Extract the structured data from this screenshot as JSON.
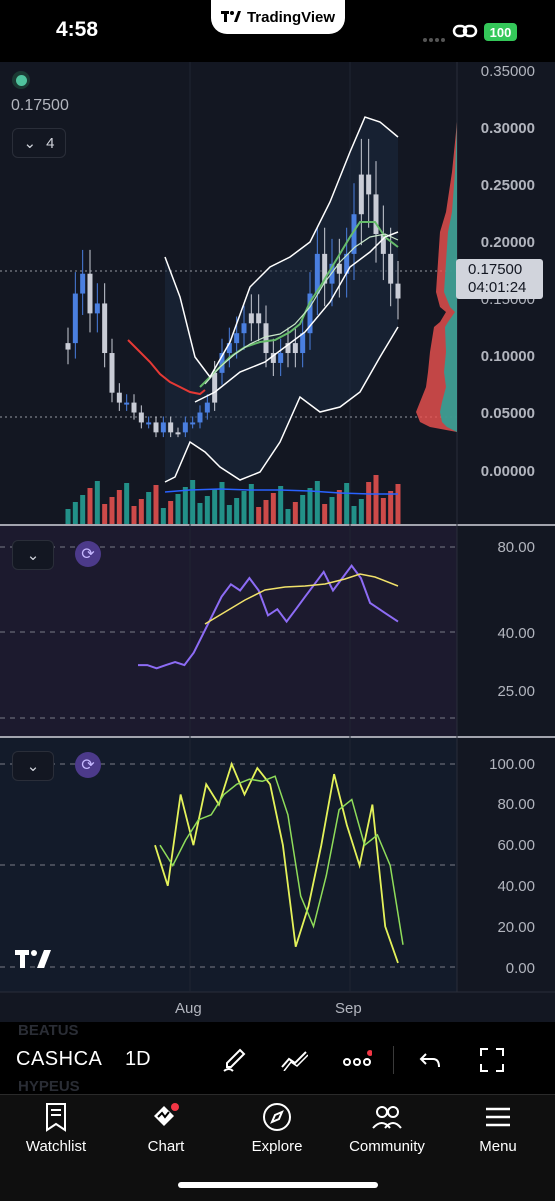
{
  "status_bar": {
    "time": "4:58",
    "brand": "TradingView",
    "battery": "100",
    "icons": [
      "signal-dots-icon",
      "link-icon",
      "battery-icon"
    ]
  },
  "chart": {
    "last_price": "0.17500",
    "indicator_count": "4",
    "price_badge_price": "0.17500",
    "price_badge_countdown": "04:01:24",
    "price_axis": [
      "0.35000",
      "0.30000",
      "0.25000",
      "0.20000",
      "0.15000",
      "0.10000",
      "0.05000",
      "0.00000"
    ],
    "rsi_axis": [
      "80.00",
      "40.00",
      "25.00"
    ],
    "stoch_axis": [
      "100.00",
      "80.00",
      "60.00",
      "40.00",
      "20.00",
      "0.00"
    ],
    "date_axis": [
      "Aug",
      "Sep"
    ],
    "colors": {
      "up": "#26a69a",
      "down": "#ef5350",
      "candle_up_blue": "#4a7fe0",
      "candle_white": "#c9ccd6",
      "rsi": "#8d6cf5",
      "rsi_ma": "#f1e26a",
      "stoch_k": "#e4f25a",
      "stoch_d": "#8fdc5a",
      "background": "#131722"
    }
  },
  "chart_data": {
    "type": "line",
    "x_labels": [
      "Aug",
      "Sep"
    ],
    "price_ylim": [
      0,
      0.35
    ],
    "last_price": 0.175,
    "close": [
      0.13,
      0.18,
      0.2,
      0.16,
      0.17,
      0.12,
      0.08,
      0.07,
      0.07,
      0.06,
      0.05,
      0.05,
      0.04,
      0.05,
      0.04,
      0.04,
      0.05,
      0.05,
      0.06,
      0.07,
      0.1,
      0.12,
      0.13,
      0.14,
      0.15,
      0.16,
      0.15,
      0.12,
      0.11,
      0.12,
      0.13,
      0.12,
      0.14,
      0.18,
      0.22,
      0.19,
      0.21,
      0.2,
      0.22,
      0.26,
      0.3,
      0.28,
      0.24,
      0.22,
      0.19,
      0.175
    ],
    "rsi": [
      42,
      42,
      41,
      42,
      43,
      42,
      46,
      52,
      58,
      64,
      68,
      66,
      70,
      66,
      58,
      60,
      56,
      60,
      64,
      68,
      72,
      66,
      70,
      74,
      70,
      62,
      60,
      58,
      56
    ],
    "rsi_ylim": [
      20,
      85
    ],
    "stoch_k": [
      60,
      40,
      85,
      60,
      90,
      80,
      100,
      85,
      98,
      90,
      60,
      10,
      30,
      60,
      95,
      70,
      50,
      80,
      20,
      2
    ],
    "stoch_ylim": [
      0,
      100
    ]
  },
  "toolbar": {
    "symbol": "CASHCA",
    "symbol_prev": "BEATUS",
    "symbol_next": "HYPEUS",
    "interval": "1D",
    "tools": [
      "brush-icon",
      "trend-line-icon",
      "more-icon",
      "undo-icon",
      "fullscreen-icon"
    ]
  },
  "tabs": [
    {
      "label": "Watchlist",
      "icon": "watchlist-icon"
    },
    {
      "label": "Chart",
      "icon": "chart-icon"
    },
    {
      "label": "Explore",
      "icon": "compass-icon"
    },
    {
      "label": "Community",
      "icon": "community-icon"
    },
    {
      "label": "Menu",
      "icon": "menu-icon"
    }
  ]
}
